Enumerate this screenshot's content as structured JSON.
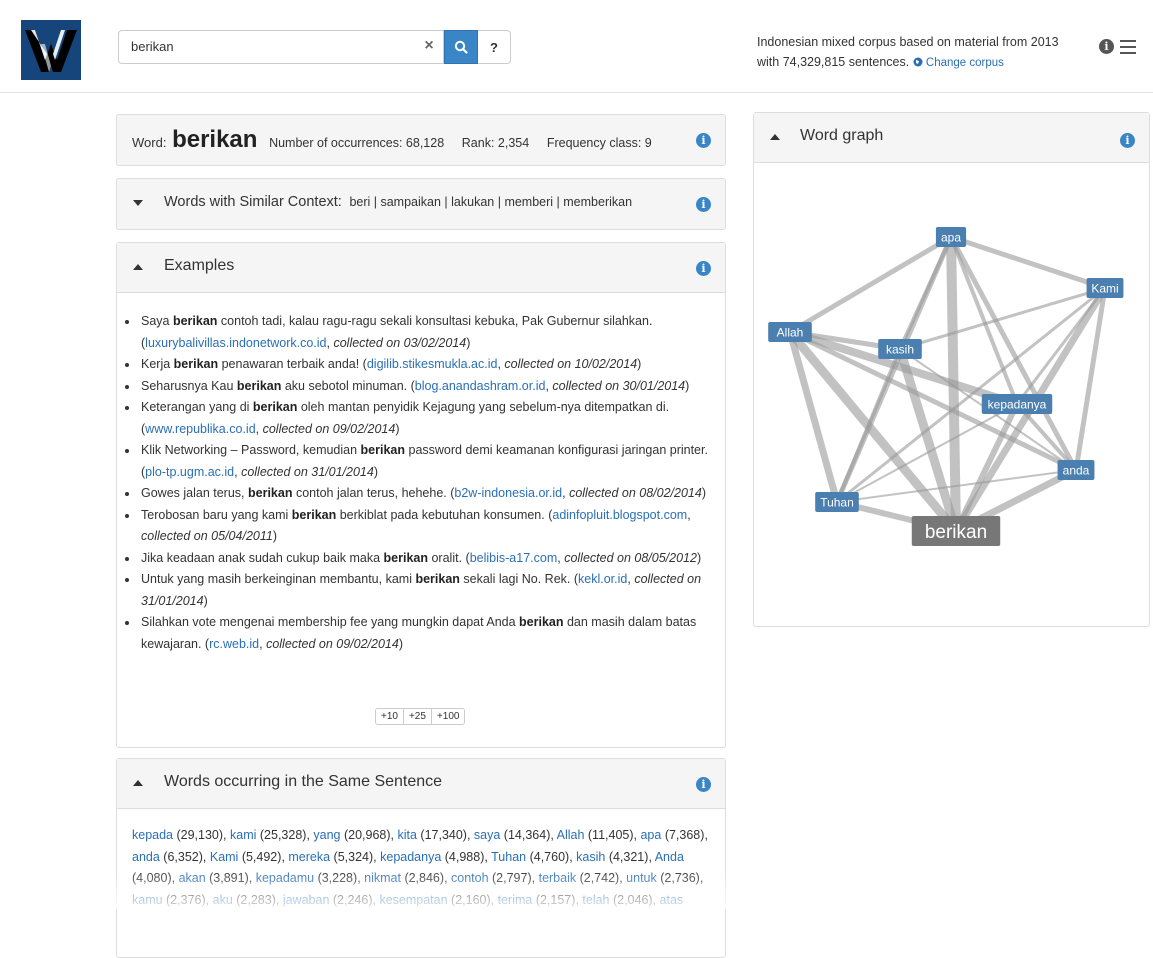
{
  "search": {
    "value": "berikan",
    "clear_icon": "close-icon",
    "search_icon": "search-icon",
    "help_label": "?"
  },
  "corpus": {
    "line1": "Indonesian mixed corpus based on material from 2013",
    "line2": "with 74,329,815 sentences.",
    "change_label": "Change corpus"
  },
  "header_icons": {
    "info": "info-icon",
    "menu": "menu-icon"
  },
  "word_panel": {
    "word_prefix": "Word:",
    "word": "berikan",
    "occurrences": "Number of occurrences: 68,128",
    "rank": "Rank: 2,354",
    "freq": "Frequency class: 9"
  },
  "similar": {
    "title": "Words with Similar Context:",
    "words": [
      "beri",
      "sampaikan",
      "lakukan",
      "memberi",
      "memberikan"
    ],
    "sep": " | "
  },
  "examples": {
    "title": "Examples",
    "items": [
      {
        "pre": "Saya ",
        "kw": "berikan",
        "post": " contoh tadi, kalau ragu-ragu sekali konsultasi kebuka, Pak Gubernur silahkan. (",
        "src": "luxurybalivillas.indonetwork.co.id",
        "col": "collected on 03/02/2014",
        "end": ")"
      },
      {
        "pre": "Kerja ",
        "kw": "berikan",
        "post": " penawaran terbaik anda! (",
        "src": "digilib.stikesmukla.ac.id",
        "col": "collected on 10/02/2014",
        "end": ")"
      },
      {
        "pre": "Seharusnya Kau ",
        "kw": "berikan",
        "post": " aku sebotol minuman. (",
        "src": "blog.anandashram.or.id",
        "col": "collected on 30/01/2014",
        "end": ")"
      },
      {
        "pre": "Keterangan yang di ",
        "kw": "berikan",
        "post": " oleh mantan penyidik Kejagung yang sebelum-nya ditempatkan di. (",
        "src": "www.republika.co.id",
        "col": "collected on 09/02/2014",
        "end": ")"
      },
      {
        "pre": "Klik Networking – Password, kemudian ",
        "kw": "berikan",
        "post": " password demi keamanan konfigurasi jaringan printer. (",
        "src": "plo-tp.ugm.ac.id",
        "col": "collected on 31/01/2014",
        "end": ")"
      },
      {
        "pre": "Gowes jalan terus, ",
        "kw": "berikan",
        "post": " contoh jalan terus, hehehe. (",
        "src": "b2w-indonesia.or.id",
        "col": "collected on 08/02/2014",
        "end": ")"
      },
      {
        "pre": "Terobosan baru yang kami ",
        "kw": "berikan",
        "post": " berkiblat pada kebutuhan konsumen. (",
        "src": "adinfopluit.blogspot.com",
        "col": "collected on 05/04/2011",
        "end": ")"
      },
      {
        "pre": "Jika keadaan anak sudah cukup baik maka ",
        "kw": "berikan",
        "post": " oralit. (",
        "src": "belibis-a17.com",
        "col": "collected on 08/05/2012",
        "end": ")"
      },
      {
        "pre": "Untuk yang masih berkeinginan membantu, kami ",
        "kw": "berikan",
        "post": " sekali lagi No. Rek. (",
        "src": "kekl.or.id",
        "col": "collected on 31/01/2014",
        "end": ")"
      },
      {
        "pre": "Silahkan vote mengenai membership fee yang mungkin dapat Anda ",
        "kw": "berikan",
        "post": " dan masih dalam batas kewajaran. (",
        "src": "rc.web.id",
        "col": "collected on 09/02/2014",
        "end": ")"
      }
    ],
    "more": [
      "+10",
      "+25",
      "+100"
    ]
  },
  "cooc": {
    "title": "Words occurring in the Same Sentence",
    "items": [
      {
        "w": "kepada",
        "n": "(29,130)"
      },
      {
        "w": "kami",
        "n": "(25,328)"
      },
      {
        "w": "yang",
        "n": "(20,968)"
      },
      {
        "w": "kita",
        "n": "(17,340)"
      },
      {
        "w": "saya",
        "n": "(14,364)"
      },
      {
        "w": "Allah",
        "n": "(11,405)"
      },
      {
        "w": "apa",
        "n": "(7,368)"
      },
      {
        "w": "anda",
        "n": "(6,352)"
      },
      {
        "w": "Kami",
        "n": "(5,492)"
      },
      {
        "w": "mereka",
        "n": "(5,324)"
      },
      {
        "w": "kepadanya",
        "n": "(4,988)"
      },
      {
        "w": "Tuhan",
        "n": "(4,760)"
      },
      {
        "w": "kasih",
        "n": "(4,321)"
      },
      {
        "w": "Anda",
        "n": "(4,080)"
      },
      {
        "w": "akan",
        "n": "(3,891)"
      },
      {
        "w": "kepadamu",
        "n": "(3,228)"
      },
      {
        "w": "nikmat",
        "n": "(2,846)"
      },
      {
        "w": "contoh",
        "n": "(2,797)"
      },
      {
        "w": "terbaik",
        "n": "(2,742)"
      },
      {
        "w": "untuk",
        "n": "(2,736)"
      },
      {
        "w": "kamu",
        "n": "(2,376)"
      },
      {
        "w": "aku",
        "n": "(2,283)"
      },
      {
        "w": "jawaban",
        "n": "(2,246)"
      },
      {
        "w": "kesempatan",
        "n": "(2,160)"
      },
      {
        "w": "terima",
        "n": "(2,157)"
      },
      {
        "w": "telah",
        "n": "(2,046)"
      },
      {
        "w": "atas",
        "n": ""
      }
    ]
  },
  "graph": {
    "title": "Word graph",
    "nodes": [
      "apa",
      "Kami",
      "Allah",
      "kasih",
      "kepadanya",
      "anda",
      "Tuhan",
      "berikan"
    ]
  },
  "colors": {
    "accent": "#3a85c6",
    "node": "#4a7fb0",
    "center_node": "#777777",
    "edge": "#999999",
    "link": "#2a6fb5"
  }
}
